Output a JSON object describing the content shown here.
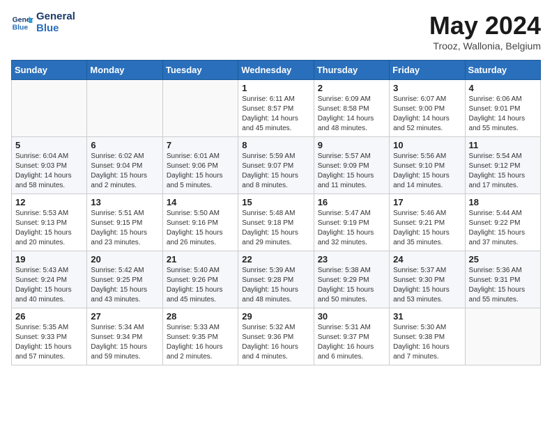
{
  "header": {
    "logo_line1": "General",
    "logo_line2": "Blue",
    "month": "May 2024",
    "location": "Trooz, Wallonia, Belgium"
  },
  "days_of_week": [
    "Sunday",
    "Monday",
    "Tuesday",
    "Wednesday",
    "Thursday",
    "Friday",
    "Saturday"
  ],
  "weeks": [
    [
      {
        "day": "",
        "sunrise": "",
        "sunset": "",
        "daylight": ""
      },
      {
        "day": "",
        "sunrise": "",
        "sunset": "",
        "daylight": ""
      },
      {
        "day": "",
        "sunrise": "",
        "sunset": "",
        "daylight": ""
      },
      {
        "day": "1",
        "sunrise": "Sunrise: 6:11 AM",
        "sunset": "Sunset: 8:57 PM",
        "daylight": "Daylight: 14 hours and 45 minutes."
      },
      {
        "day": "2",
        "sunrise": "Sunrise: 6:09 AM",
        "sunset": "Sunset: 8:58 PM",
        "daylight": "Daylight: 14 hours and 48 minutes."
      },
      {
        "day": "3",
        "sunrise": "Sunrise: 6:07 AM",
        "sunset": "Sunset: 9:00 PM",
        "daylight": "Daylight: 14 hours and 52 minutes."
      },
      {
        "day": "4",
        "sunrise": "Sunrise: 6:06 AM",
        "sunset": "Sunset: 9:01 PM",
        "daylight": "Daylight: 14 hours and 55 minutes."
      }
    ],
    [
      {
        "day": "5",
        "sunrise": "Sunrise: 6:04 AM",
        "sunset": "Sunset: 9:03 PM",
        "daylight": "Daylight: 14 hours and 58 minutes."
      },
      {
        "day": "6",
        "sunrise": "Sunrise: 6:02 AM",
        "sunset": "Sunset: 9:04 PM",
        "daylight": "Daylight: 15 hours and 2 minutes."
      },
      {
        "day": "7",
        "sunrise": "Sunrise: 6:01 AM",
        "sunset": "Sunset: 9:06 PM",
        "daylight": "Daylight: 15 hours and 5 minutes."
      },
      {
        "day": "8",
        "sunrise": "Sunrise: 5:59 AM",
        "sunset": "Sunset: 9:07 PM",
        "daylight": "Daylight: 15 hours and 8 minutes."
      },
      {
        "day": "9",
        "sunrise": "Sunrise: 5:57 AM",
        "sunset": "Sunset: 9:09 PM",
        "daylight": "Daylight: 15 hours and 11 minutes."
      },
      {
        "day": "10",
        "sunrise": "Sunrise: 5:56 AM",
        "sunset": "Sunset: 9:10 PM",
        "daylight": "Daylight: 15 hours and 14 minutes."
      },
      {
        "day": "11",
        "sunrise": "Sunrise: 5:54 AM",
        "sunset": "Sunset: 9:12 PM",
        "daylight": "Daylight: 15 hours and 17 minutes."
      }
    ],
    [
      {
        "day": "12",
        "sunrise": "Sunrise: 5:53 AM",
        "sunset": "Sunset: 9:13 PM",
        "daylight": "Daylight: 15 hours and 20 minutes."
      },
      {
        "day": "13",
        "sunrise": "Sunrise: 5:51 AM",
        "sunset": "Sunset: 9:15 PM",
        "daylight": "Daylight: 15 hours and 23 minutes."
      },
      {
        "day": "14",
        "sunrise": "Sunrise: 5:50 AM",
        "sunset": "Sunset: 9:16 PM",
        "daylight": "Daylight: 15 hours and 26 minutes."
      },
      {
        "day": "15",
        "sunrise": "Sunrise: 5:48 AM",
        "sunset": "Sunset: 9:18 PM",
        "daylight": "Daylight: 15 hours and 29 minutes."
      },
      {
        "day": "16",
        "sunrise": "Sunrise: 5:47 AM",
        "sunset": "Sunset: 9:19 PM",
        "daylight": "Daylight: 15 hours and 32 minutes."
      },
      {
        "day": "17",
        "sunrise": "Sunrise: 5:46 AM",
        "sunset": "Sunset: 9:21 PM",
        "daylight": "Daylight: 15 hours and 35 minutes."
      },
      {
        "day": "18",
        "sunrise": "Sunrise: 5:44 AM",
        "sunset": "Sunset: 9:22 PM",
        "daylight": "Daylight: 15 hours and 37 minutes."
      }
    ],
    [
      {
        "day": "19",
        "sunrise": "Sunrise: 5:43 AM",
        "sunset": "Sunset: 9:24 PM",
        "daylight": "Daylight: 15 hours and 40 minutes."
      },
      {
        "day": "20",
        "sunrise": "Sunrise: 5:42 AM",
        "sunset": "Sunset: 9:25 PM",
        "daylight": "Daylight: 15 hours and 43 minutes."
      },
      {
        "day": "21",
        "sunrise": "Sunrise: 5:40 AM",
        "sunset": "Sunset: 9:26 PM",
        "daylight": "Daylight: 15 hours and 45 minutes."
      },
      {
        "day": "22",
        "sunrise": "Sunrise: 5:39 AM",
        "sunset": "Sunset: 9:28 PM",
        "daylight": "Daylight: 15 hours and 48 minutes."
      },
      {
        "day": "23",
        "sunrise": "Sunrise: 5:38 AM",
        "sunset": "Sunset: 9:29 PM",
        "daylight": "Daylight: 15 hours and 50 minutes."
      },
      {
        "day": "24",
        "sunrise": "Sunrise: 5:37 AM",
        "sunset": "Sunset: 9:30 PM",
        "daylight": "Daylight: 15 hours and 53 minutes."
      },
      {
        "day": "25",
        "sunrise": "Sunrise: 5:36 AM",
        "sunset": "Sunset: 9:31 PM",
        "daylight": "Daylight: 15 hours and 55 minutes."
      }
    ],
    [
      {
        "day": "26",
        "sunrise": "Sunrise: 5:35 AM",
        "sunset": "Sunset: 9:33 PM",
        "daylight": "Daylight: 15 hours and 57 minutes."
      },
      {
        "day": "27",
        "sunrise": "Sunrise: 5:34 AM",
        "sunset": "Sunset: 9:34 PM",
        "daylight": "Daylight: 15 hours and 59 minutes."
      },
      {
        "day": "28",
        "sunrise": "Sunrise: 5:33 AM",
        "sunset": "Sunset: 9:35 PM",
        "daylight": "Daylight: 16 hours and 2 minutes."
      },
      {
        "day": "29",
        "sunrise": "Sunrise: 5:32 AM",
        "sunset": "Sunset: 9:36 PM",
        "daylight": "Daylight: 16 hours and 4 minutes."
      },
      {
        "day": "30",
        "sunrise": "Sunrise: 5:31 AM",
        "sunset": "Sunset: 9:37 PM",
        "daylight": "Daylight: 16 hours and 6 minutes."
      },
      {
        "day": "31",
        "sunrise": "Sunrise: 5:30 AM",
        "sunset": "Sunset: 9:38 PM",
        "daylight": "Daylight: 16 hours and 7 minutes."
      },
      {
        "day": "",
        "sunrise": "",
        "sunset": "",
        "daylight": ""
      }
    ]
  ]
}
